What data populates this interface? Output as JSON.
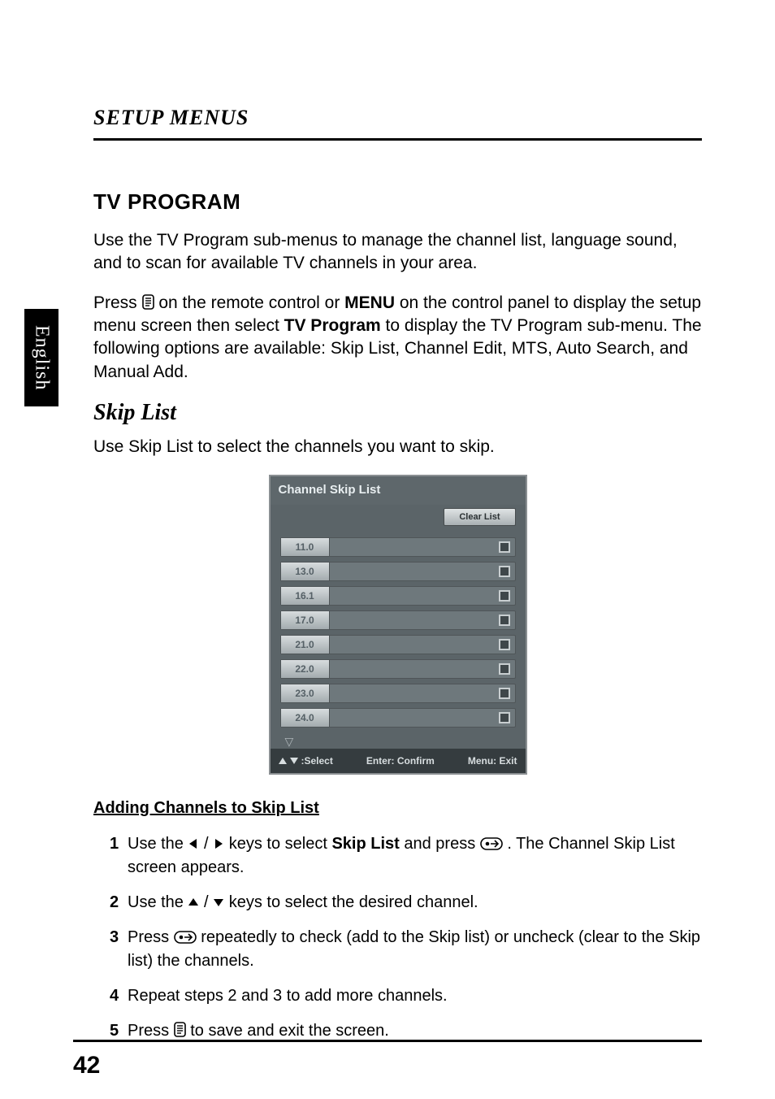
{
  "side_tab": "English",
  "section_header": "SETUP MENUS",
  "h1": "TV PROGRAM",
  "intro_para": "Use the TV Program sub-menus to manage the channel list, language sound, and to scan for available TV channels in your area.",
  "press_para_1a": "Press ",
  "press_para_1b": " on the remote control or ",
  "press_para_menu": "MENU",
  "press_para_1c": " on the control panel to display the setup menu screen then select ",
  "press_para_tv": "TV Program",
  "press_para_1d": " to display the TV Program sub-menu. The following options are available: Skip List, Channel Edit, MTS, Auto Search, and Manual Add.",
  "h2": "Skip List",
  "skip_intro": "Use Skip List to select the channels you want to skip.",
  "dialog": {
    "title": "Channel Skip List",
    "clear_btn": "Clear List",
    "channels": [
      "11.0",
      "13.0",
      "16.1",
      "17.0",
      "21.0",
      "22.0",
      "23.0",
      "24.0"
    ],
    "footer_select": ":Select",
    "footer_enter": "Enter: Confirm",
    "footer_menu": "Menu: Exit"
  },
  "adding_header": "Adding Channels to Skip List",
  "steps": {
    "s1a": "Use the ",
    "s1b": " / ",
    "s1c": " keys to select ",
    "s1_skip": "Skip List",
    "s1d": " and press ",
    "s1e": ". The Channel Skip List screen appears.",
    "s2a": "Use the ",
    "s2b": " / ",
    "s2c": " keys to select the desired channel.",
    "s3a": "Press ",
    "s3b": " repeatedly to check (add to the Skip list) or uncheck (clear to the Skip list) the channels.",
    "s4": "Repeat steps 2 and 3 to add more channels.",
    "s5a": "Press ",
    "s5b": " to save and exit the screen."
  },
  "page_number": "42"
}
